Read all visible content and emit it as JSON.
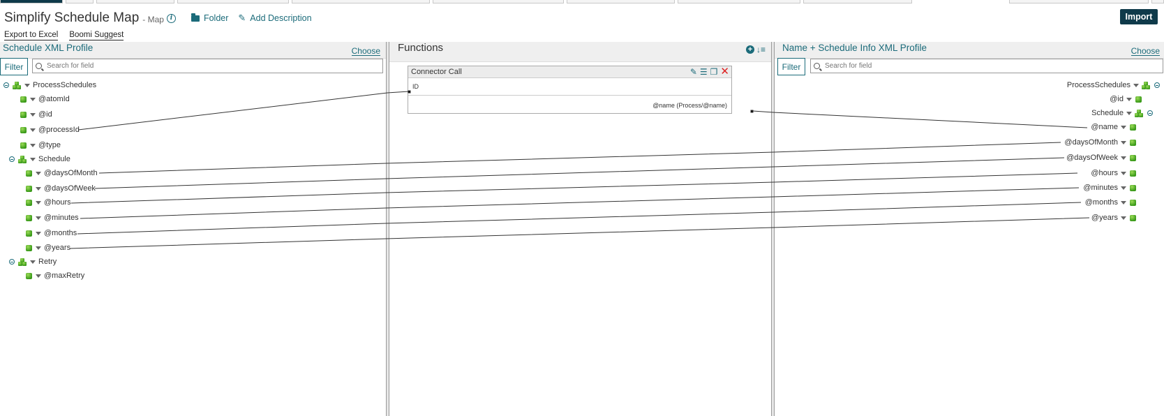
{
  "header": {
    "title": "Simplify Schedule Map",
    "subtitle": "- Map",
    "folder_label": "Folder",
    "add_description_label": "Add Description",
    "import_label": "Import"
  },
  "actions": {
    "export_label": "Export to Excel",
    "suggest_label": "Boomi Suggest"
  },
  "source": {
    "title": "Schedule XML Profile",
    "choose_label": "Choose",
    "filter_label": "Filter",
    "search_placeholder": "Search for field",
    "nodes": [
      {
        "label": "ProcessSchedules",
        "kind": "group",
        "collapsible": true
      },
      {
        "label": "@atomId",
        "kind": "field"
      },
      {
        "label": "@id",
        "kind": "field"
      },
      {
        "label": "@processId",
        "kind": "field"
      },
      {
        "label": "@type",
        "kind": "field"
      },
      {
        "label": "Schedule",
        "kind": "group",
        "collapsible": true
      },
      {
        "label": "@daysOfMonth",
        "kind": "field"
      },
      {
        "label": "@daysOfWeek",
        "kind": "field"
      },
      {
        "label": "@hours",
        "kind": "field"
      },
      {
        "label": "@minutes",
        "kind": "field"
      },
      {
        "label": "@months",
        "kind": "field"
      },
      {
        "label": "@years",
        "kind": "field"
      },
      {
        "label": "Retry",
        "kind": "group",
        "collapsible": true
      },
      {
        "label": "@maxRetry",
        "kind": "field"
      }
    ]
  },
  "functions": {
    "title": "Functions",
    "box": {
      "title": "Connector Call",
      "input_label": "ID",
      "output_label": "@name (Process/@name)"
    }
  },
  "target": {
    "title": "Name + Schedule Info XML Profile",
    "choose_label": "Choose",
    "filter_label": "Filter",
    "search_placeholder": "Search for field",
    "nodes": [
      {
        "label": "ProcessSchedules",
        "kind": "group",
        "collapsible": true
      },
      {
        "label": "@id",
        "kind": "field"
      },
      {
        "label": "Schedule",
        "kind": "group",
        "collapsible": true
      },
      {
        "label": "@name",
        "kind": "field"
      },
      {
        "label": "@daysOfMonth",
        "kind": "field"
      },
      {
        "label": "@daysOfWeek",
        "kind": "field"
      },
      {
        "label": "@hours",
        "kind": "field"
      },
      {
        "label": "@minutes",
        "kind": "field"
      },
      {
        "label": "@months",
        "kind": "field"
      },
      {
        "label": "@years",
        "kind": "field"
      }
    ]
  }
}
